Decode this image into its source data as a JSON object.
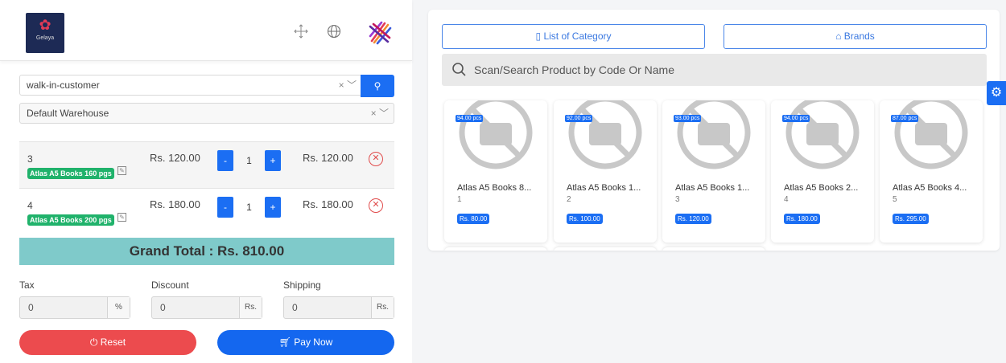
{
  "header": {
    "logo_text": "Gelaya",
    "fullscreen_icon": "expand-arrows-icon",
    "language_icon": "globe-icon"
  },
  "pos": {
    "customer": "walk-in-customer",
    "warehouse": "Default Warehouse",
    "clear_glyph": "×",
    "dropdown_glyph": "⌄",
    "items": [
      {
        "code": "3",
        "name": "Atlas A5 Books 160 pgs",
        "price": "Rs. 120.00",
        "qty": "1",
        "subtotal": "Rs. 120.00"
      },
      {
        "code": "4",
        "name": "Atlas A5 Books 200 pgs",
        "price": "Rs. 180.00",
        "qty": "1",
        "subtotal": "Rs. 180.00"
      }
    ],
    "minus_label": "-",
    "plus_label": "+",
    "grand_total": "Grand Total : Rs. 810.00",
    "tax_label": "Tax",
    "discount_label": "Discount",
    "shipping_label": "Shipping",
    "tax_value": "0",
    "discount_value": "0",
    "shipping_value": "0",
    "tax_unit": "%",
    "discount_unit": "Rs.",
    "shipping_unit": "Rs.",
    "reset_label": "⏻ Reset",
    "pay_label": "Pay Now"
  },
  "catalog": {
    "category_label": "List of Category",
    "brands_label": "Brands",
    "search_placeholder": "Scan/Search Product by Code Or Name",
    "products": [
      {
        "stock": "94.00 pcs",
        "name": "Atlas A5 Books 8...",
        "code": "1",
        "price": "Rs. 80.00"
      },
      {
        "stock": "92.00 pcs",
        "name": "Atlas A5 Books 1...",
        "code": "2",
        "price": "Rs. 100.00"
      },
      {
        "stock": "93.00 pcs",
        "name": "Atlas A5 Books 1...",
        "code": "3",
        "price": "Rs. 120.00"
      },
      {
        "stock": "94.00 pcs",
        "name": "Atlas A5 Books 2...",
        "code": "4",
        "price": "Rs. 180.00"
      },
      {
        "stock": "87.00 pcs",
        "name": "Atlas A5 Books 4...",
        "code": "5",
        "price": "Rs. 295.00"
      }
    ]
  },
  "colors": {
    "primary": "#1b6ef3",
    "danger": "#ec4b4e",
    "success_tag": "#20b26b",
    "grand_total_bg": "#7fcaca"
  }
}
